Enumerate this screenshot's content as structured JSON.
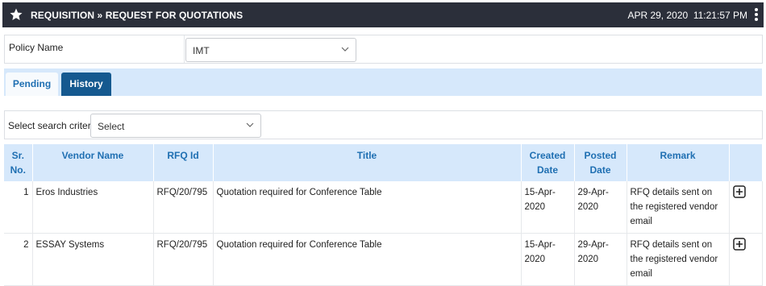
{
  "header": {
    "title": "REQUISITION » REQUEST FOR QUOTATIONS",
    "date": "APR 29, 2020",
    "time": "11:21:57 PM"
  },
  "policy": {
    "label": "Policy Name",
    "value": "IMT"
  },
  "tabs": [
    {
      "label": "Pending"
    },
    {
      "label": "History"
    }
  ],
  "active_tab": "History",
  "search": {
    "label": "Select search criteria:",
    "value": "Select"
  },
  "table": {
    "columns": [
      {
        "label": "Sr. No."
      },
      {
        "label": "Vendor Name"
      },
      {
        "label": "RFQ Id"
      },
      {
        "label": "Title"
      },
      {
        "label": "Created Date"
      },
      {
        "label": "Posted Date"
      },
      {
        "label": "Remark"
      },
      {
        "label": ""
      }
    ],
    "rows": [
      {
        "sr": "1",
        "vendor": "Eros Industries",
        "rfq": "RFQ/20/795",
        "title": "Quotation required for Conference Table",
        "created": "15-Apr-2020",
        "posted": "29-Apr-2020",
        "remark": "RFQ details sent on the registered vendor email"
      },
      {
        "sr": "2",
        "vendor": "ESSAY Systems",
        "rfq": "RFQ/20/795",
        "title": "Quotation required for Conference Table",
        "created": "15-Apr-2020",
        "posted": "29-Apr-2020",
        "remark": "RFQ details sent on the registered vendor email"
      }
    ]
  },
  "colors": {
    "topbar": "#2b2f3a",
    "accent": "#1f6fb2",
    "active_tab": "#15598f",
    "header_bg": "#d6e8fb"
  },
  "icons": [
    "star-icon",
    "kebab-menu-icon",
    "chevron-down-icon",
    "expand-plus-icon"
  ]
}
